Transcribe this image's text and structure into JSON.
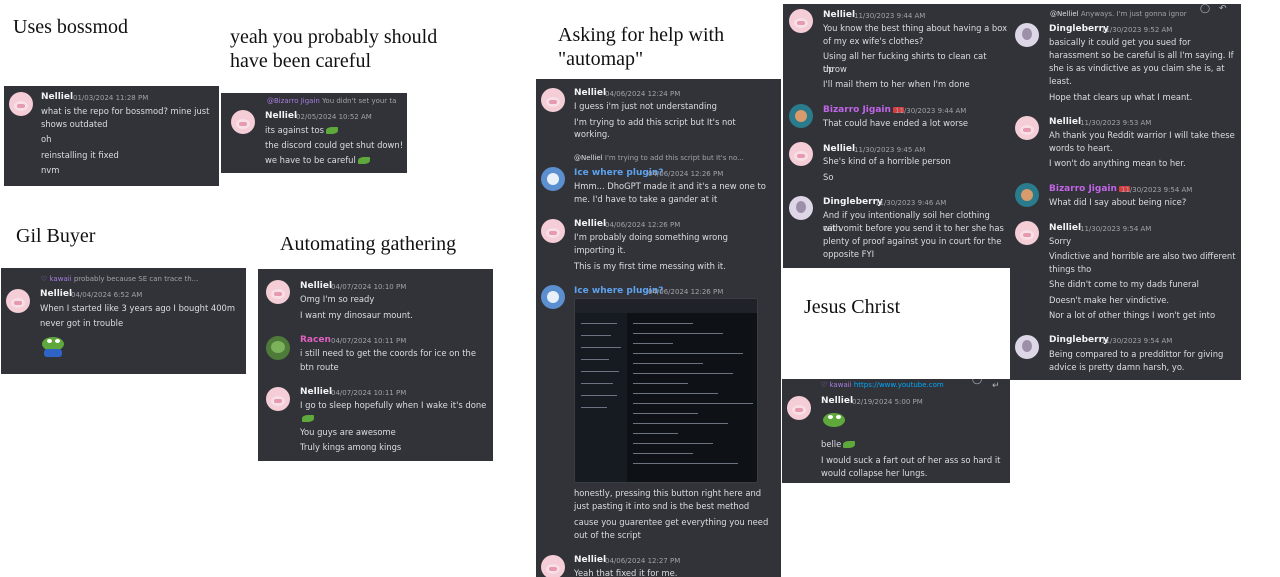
{
  "captions": {
    "bossmod": "Uses bossmod",
    "careful_1": "yeah you probably should",
    "careful_2": "have been careful",
    "automap_1": "Asking for help with",
    "automap_2": "\"automap\"",
    "gil": "Gil Buyer",
    "gathering": "Automating gathering",
    "jesus": "Jesus Christ"
  },
  "bossmod": {
    "name": "Nelliel",
    "time": "01/03/2024 11:28 PM",
    "lines": [
      "what is the repo for bossmod? mine just",
      "shows outdated",
      "oh",
      "reinstalling it fixed",
      "nvm"
    ]
  },
  "careful": {
    "reply_name": "@Bizarro Jigain",
    "reply_text": "You didn't set your ta",
    "name": "Nelliel",
    "time": "02/05/2024 10:52 AM",
    "lines": [
      "its against tos",
      "the discord could get shut down!",
      "we have to be careful"
    ]
  },
  "gil": {
    "reply_name": "♡ kawaii",
    "reply_text": "probably because SE can trace th...",
    "name": "Nelliel",
    "time": "04/04/2024 6:52 AM",
    "lines": [
      "When I started like 3 years ago I bought 400m",
      "never got in trouble"
    ]
  },
  "gathering": {
    "m1": {
      "name": "Nelliel",
      "time": "04/07/2024 10:10 PM",
      "lines": [
        "Omg I'm so ready",
        "I want my dinosaur mount."
      ]
    },
    "m2": {
      "name": "Racen",
      "time": "04/07/2024 10:11 PM",
      "lines": [
        "i still need to get the coords for ice on the",
        "btn route"
      ]
    },
    "m3": {
      "name": "Nelliel",
      "time": "04/07/2024 10:11 PM",
      "lines": [
        "I go to sleep hopefully when I wake it's done",
        "You guys are awesome",
        "Truly kings among kings"
      ]
    }
  },
  "automap": {
    "m1": {
      "name": "Nelliel",
      "time": "04/06/2024 12:24 PM",
      "lines": [
        "I guess i'm just not understanding",
        "I'm trying to add this script but It's not",
        "working."
      ]
    },
    "m2": {
      "reply_name": "@Nelliel",
      "reply_text": "I'm trying to add this script but It's no...",
      "name": "Ice where plugin?",
      "time": "04/06/2024 12:26 PM",
      "lines": [
        "Hmm... DhoGPT made it and it's a new one to",
        "me. I'd have to take a gander at it"
      ]
    },
    "m3": {
      "name": "Nelliel",
      "time": "04/06/2024 12:26 PM",
      "lines": [
        "I'm probably doing something wrong",
        "importing it.",
        "This is my first time messing with it."
      ]
    },
    "m4": {
      "name": "Ice where plugin?",
      "time": "04/06/2024 12:26 PM",
      "lines": [
        "honestly, pressing this button right here and",
        "just pasting it into snd is the best method",
        "cause you guarentee get everything you need",
        "out of the script"
      ]
    },
    "m5": {
      "name": "Nelliel",
      "time": "04/06/2024 12:27 PM",
      "lines": [
        "Yeah that fixed it for me."
      ]
    }
  },
  "ex": {
    "m1": {
      "name": "Nelliel",
      "time": "11/30/2023 9:44 AM",
      "lines": [
        "You know the best thing about having a box",
        "of my ex wife's clothes?",
        "Using all her fucking shirts to clean cat throw",
        "up",
        "I'll mail them to her when I'm done"
      ]
    },
    "m2": {
      "name": "Bizarro Jigain",
      "time": "11/30/2023 9:44 AM",
      "lines": [
        "That could have ended a lot worse"
      ]
    },
    "m3": {
      "name": "Nelliel",
      "time": "11/30/2023 9:45 AM",
      "lines": [
        "She's kind of a horrible person",
        "So"
      ]
    },
    "m4": {
      "name": "Dingleberry",
      "time": "11/30/2023 9:46 AM",
      "lines": [
        "And if you intentionally soil her clothing with",
        "cat vomit before you send it to her she has",
        "plenty of proof against you in court for the",
        "opposite FYI"
      ]
    }
  },
  "ex2": {
    "reply_name": "@Nelliel",
    "reply_text": "Anyways. I'm just gonna ignor",
    "m1": {
      "name": "Dingleberry",
      "time": "11/30/2023 9:52 AM",
      "lines": [
        "basically it could get you sued for",
        "harassment so be careful is all I'm saying. If",
        "she is as vindictive as you claim she is, at",
        "least.",
        "Hope that clears up what I meant."
      ]
    },
    "m2": {
      "name": "Nelliel",
      "time": "11/30/2023 9:53 AM",
      "lines": [
        "Ah thank you Reddit warrior I will take these",
        "words to heart.",
        "I won't do anything mean to her."
      ]
    },
    "m3": {
      "name": "Bizarro Jigain",
      "time": "11/30/2023 9:54 AM",
      "lines": [
        "What did I say about being nice?"
      ]
    },
    "m4": {
      "name": "Nelliel",
      "time": "11/30/2023 9:54 AM",
      "lines": [
        "Sorry",
        "Vindictive and horrible are also two different",
        "things tho",
        "She didn't come to my dads funeral",
        "Doesn't make her vindictive.",
        "Nor a lot of other things I won't get into"
      ]
    },
    "m5": {
      "name": "Dingleberry",
      "time": "11/30/2023 9:54 AM",
      "lines": [
        "Being compared to a preddittor for giving",
        "advice is pretty damn harsh, yo."
      ]
    }
  },
  "jesus": {
    "reply_name": "♡ kawaii",
    "reply_link": "https://www.youtube.com",
    "name": "Nelliel",
    "time": "02/19/2024 5:00 PM",
    "lines": [
      "belle",
      "I would suck a fart out of her ass so hard it",
      "would collapse her lungs."
    ]
  },
  "icons": [
    "pig-avatar-icon",
    "frog-avatar-icon",
    "ice-avatar-icon",
    "anime-avatar-icon",
    "pepe-emoji-icon",
    "leaf-emoji-icon",
    "reply-arrow-icon",
    "more-options-icon"
  ]
}
